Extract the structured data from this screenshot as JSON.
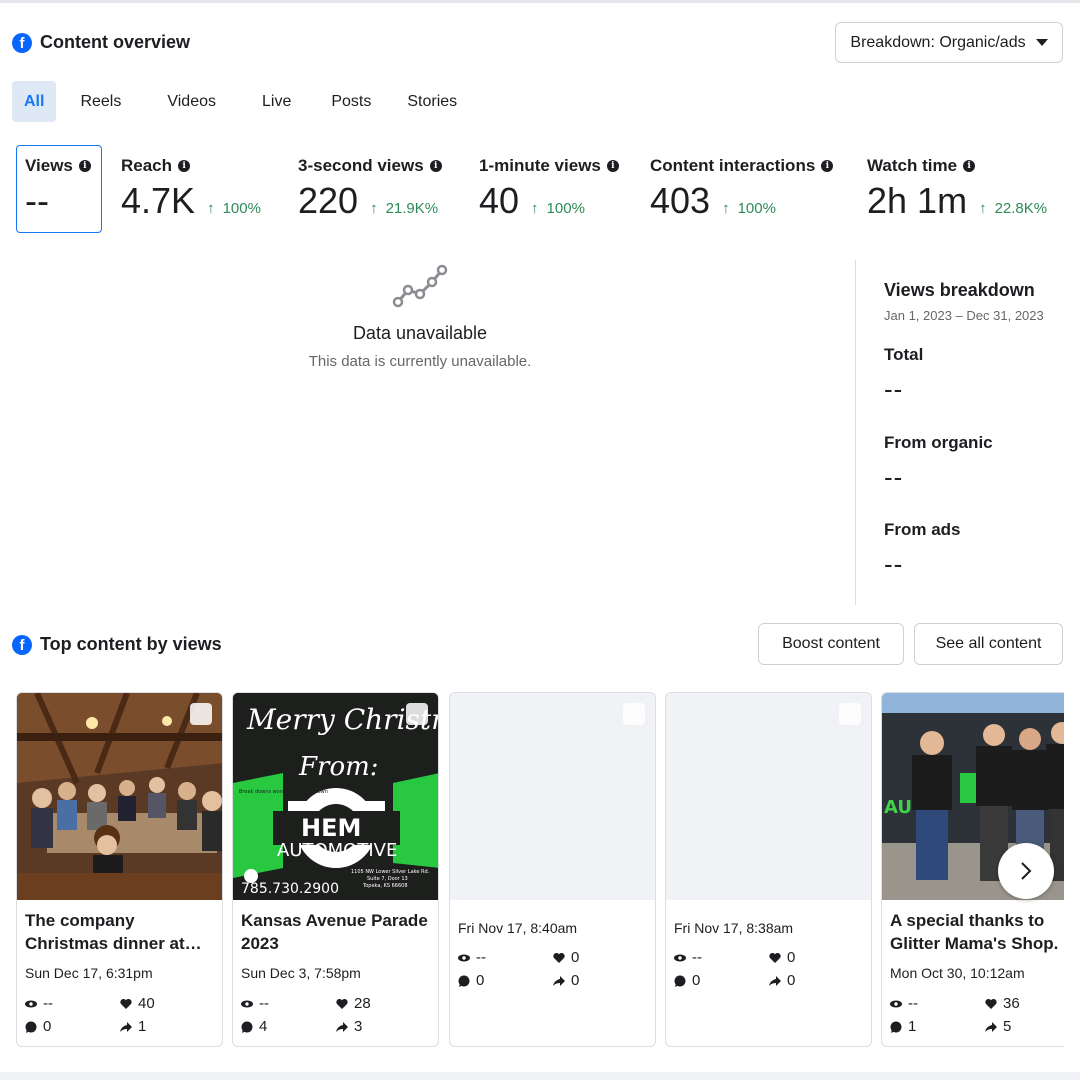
{
  "header": {
    "title": "Content overview",
    "breakdown_label": "Breakdown: Organic/ads"
  },
  "tabs": [
    {
      "label": "All",
      "active": true
    },
    {
      "label": "Reels",
      "active": false
    },
    {
      "label": "Videos",
      "active": false
    },
    {
      "label": "Live",
      "active": false
    },
    {
      "label": "Posts",
      "active": false
    },
    {
      "label": "Stories",
      "active": false
    }
  ],
  "metrics": [
    {
      "label": "Views",
      "value": "--",
      "change": ""
    },
    {
      "label": "Reach",
      "value": "4.7K",
      "change": "100%"
    },
    {
      "label": "3-second views",
      "value": "220",
      "change": "21.9K%"
    },
    {
      "label": "1-minute views",
      "value": "40",
      "change": "100%"
    },
    {
      "label": "Content interactions",
      "value": "403",
      "change": "100%"
    },
    {
      "label": "Watch time",
      "value": "2h 1m",
      "change": "22.8K%"
    }
  ],
  "unavailable": {
    "title": "Data unavailable",
    "message": "This data is currently unavailable."
  },
  "views_breakdown": {
    "title": "Views breakdown",
    "date_range": "Jan 1, 2023 – Dec 31, 2023",
    "total_label": "Total",
    "total_value": "--",
    "organic_label": "From organic",
    "organic_value": "--",
    "ads_label": "From ads",
    "ads_value": "--"
  },
  "top_content": {
    "title": "Top content by views",
    "boost_label": "Boost content",
    "see_all_label": "See all content"
  },
  "thumb2": {
    "line1": "Merry Christmas",
    "line2": "From:",
    "side": "Break downs won't break you down",
    "brand1": "HEM",
    "brand2": "AUTOMOTIVE",
    "phone": "785.730.2900",
    "address1": "1105 NW Lower Silver Lake Rd.",
    "address2": "Suite 7, Door 13",
    "address3": "Topeka, KS 66608"
  },
  "thumb5": {
    "sign": "AU"
  },
  "posts": [
    {
      "title": "The company Christmas dinner at…",
      "date": "Sun Dec 17, 6:31pm",
      "views": "--",
      "likes": "40",
      "comments": "0",
      "shares": "1"
    },
    {
      "title": "Kansas Avenue Parade 2023",
      "date": "Sun Dec 3, 7:58pm",
      "views": "--",
      "likes": "28",
      "comments": "4",
      "shares": "3"
    },
    {
      "title": "",
      "date": "Fri Nov 17, 8:40am",
      "views": "--",
      "likes": "0",
      "comments": "0",
      "shares": "0"
    },
    {
      "title": "",
      "date": "Fri Nov 17, 8:38am",
      "views": "--",
      "likes": "0",
      "comments": "0",
      "shares": "0"
    },
    {
      "title": "A special thanks to Glitter Mama's Shop.",
      "date": "Mon Oct 30, 10:12am",
      "views": "--",
      "likes": "36",
      "comments": "1",
      "shares": "5"
    }
  ]
}
